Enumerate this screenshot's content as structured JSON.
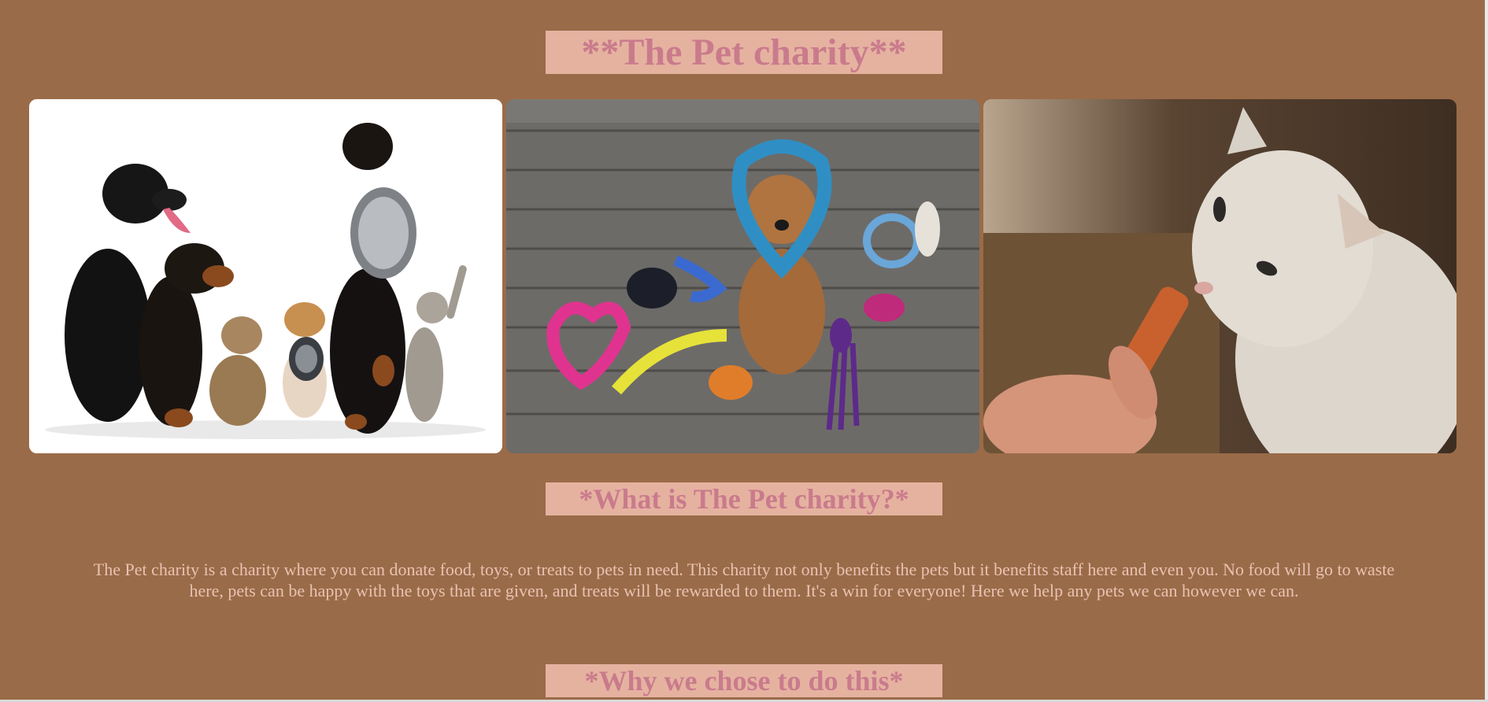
{
  "header": {
    "title": "**The Pet charity**"
  },
  "gallery": {
    "images": [
      {
        "name": "dogs-and-cats-photo",
        "subject": "group of dogs and cats, one dog holding a food bowl"
      },
      {
        "name": "dog-with-rope-toys-photo",
        "subject": "dog wearing a rope heart surrounded by rope toys on a wooden deck"
      },
      {
        "name": "cat-eating-treat-photo",
        "subject": "white cat eating a treat from a hand"
      }
    ]
  },
  "sections": {
    "what": {
      "title": "*What is The Pet charity?*",
      "body": "The Pet charity is a charity where you can donate food, toys, or treats to pets in need. This charity not only benefits the pets but it benefits staff here and even you. No food will go to waste here, pets can be happy with the toys that are given, and treats will be rewarded to them. It's a win for everyone! Here we help any pets we can however we can."
    },
    "why": {
      "title": "*Why we chose to do this*"
    }
  },
  "colors": {
    "page_background": "#9a6b48",
    "title_box_background": "#e6b2a0",
    "title_text": "#c97b8c",
    "body_text": "#e8c2b2"
  }
}
